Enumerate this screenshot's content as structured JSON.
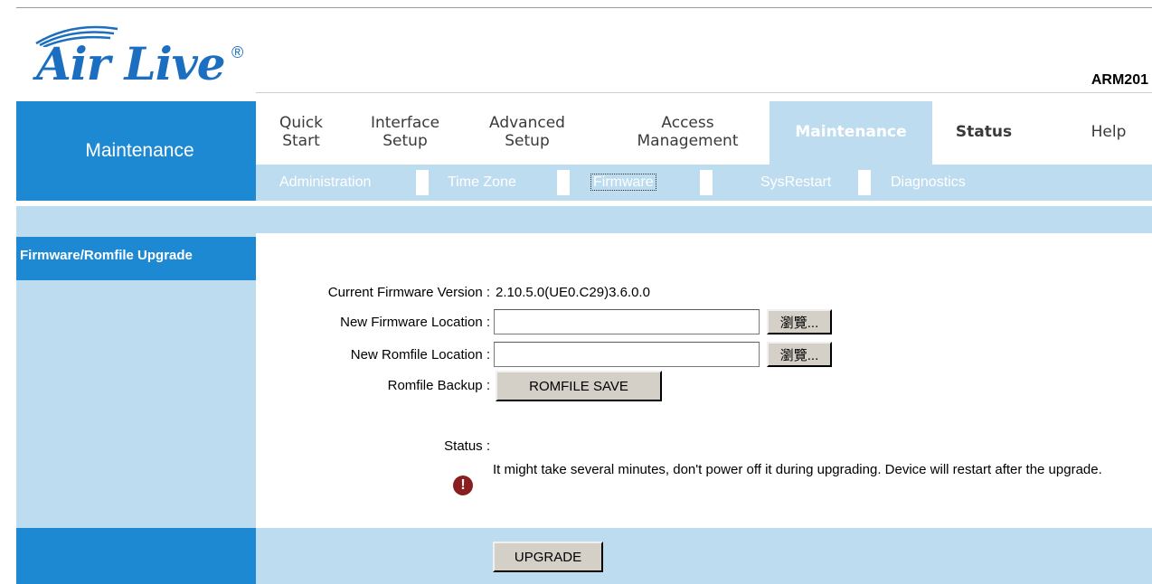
{
  "brand": {
    "logo_text": "Air Live",
    "registered": "®",
    "model": "ARM201"
  },
  "section_title": "Maintenance",
  "nav": {
    "items": [
      {
        "label": "Quick\nStart"
      },
      {
        "label": "Interface\nSetup"
      },
      {
        "label": "Advanced\nSetup"
      },
      {
        "label": "Access\nManagement"
      },
      {
        "label": "Maintenance",
        "active": true
      },
      {
        "label": "Status"
      },
      {
        "label": "Help"
      }
    ],
    "subitems": [
      {
        "label": "Administration"
      },
      {
        "label": "Time Zone"
      },
      {
        "label": "Firmware",
        "active": true
      },
      {
        "label": "SysRestart"
      },
      {
        "label": "Diagnostics"
      }
    ]
  },
  "side_label": "Firmware/Romfile Upgrade",
  "form": {
    "current_fw_label": "Current Firmware Version :",
    "current_fw_value": "2.10.5.0(UE0.C29)3.6.0.0",
    "new_fw_label": "New Firmware Location :",
    "new_fw_value": "",
    "new_romfile_label": "New Romfile Location :",
    "new_romfile_value": "",
    "browse_label": "瀏覽...",
    "romfile_backup_label": "Romfile Backup :",
    "romfile_save_label": "ROMFILE SAVE",
    "status_label": "Status :",
    "status_message": "It might take several minutes, don't power off it during upgrading. Device will restart after the upgrade."
  },
  "upgrade_label": "UPGRADE",
  "colors": {
    "primary_blue": "#1e89d3",
    "light_blue": "#bedcef",
    "logo_blue": "#1c6fc0",
    "warning_red": "#8a1d1d"
  },
  "icons": {
    "warning": "exclamation-circle-icon",
    "logo_waves": "signal-waves-icon"
  }
}
